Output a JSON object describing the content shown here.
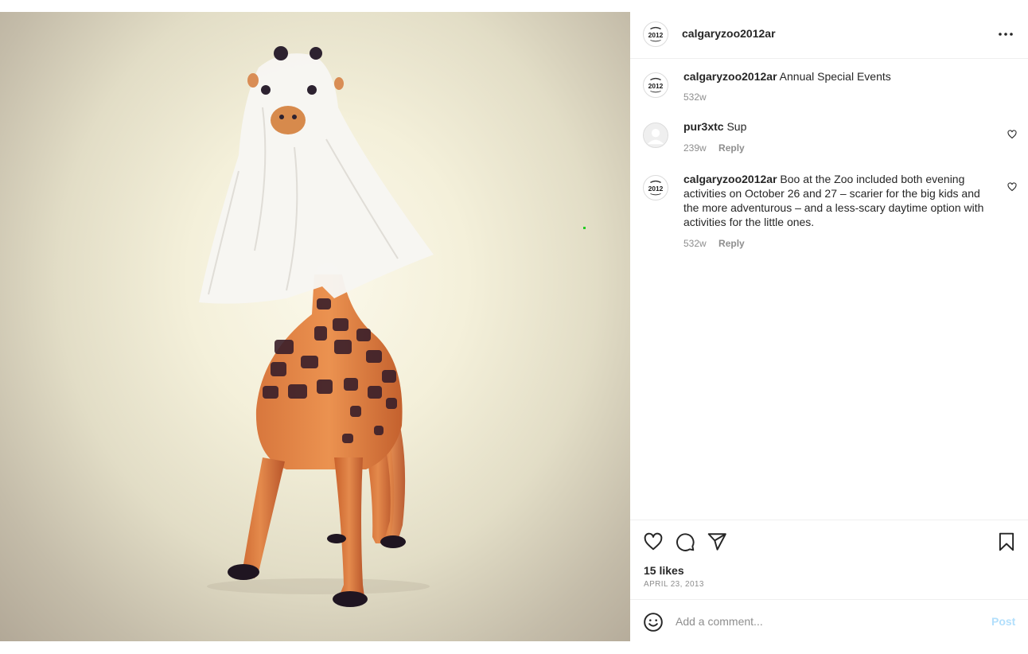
{
  "post": {
    "username": "calgaryzoo2012ar",
    "avatar_text": "2012",
    "image_alt": "Toy giraffe wearing a white tissue ghost costume"
  },
  "comments": [
    {
      "user": "calgaryzoo2012ar",
      "text": "Annual Special Events",
      "age": "532w",
      "reply": ""
    },
    {
      "user": "pur3xtc",
      "text": "Sup",
      "age": "239w",
      "reply": "Reply"
    },
    {
      "user": "calgaryzoo2012ar",
      "text": "Boo at the Zoo included both evening activities on October 26 and 27 – scarier for the big kids and the more adventurous – and a less-scary daytime option with activities for the little ones.",
      "age": "532w",
      "reply": "Reply"
    }
  ],
  "actions": {
    "likes": "15 likes",
    "date": "APRIL 23, 2013"
  },
  "add_comment": {
    "placeholder": "Add a comment...",
    "post_label": "Post"
  },
  "icons": {
    "header_more": "more-horizontal-icon",
    "like": "heart-icon",
    "comment": "comment-bubble-icon",
    "share": "paper-plane-icon",
    "save": "bookmark-icon",
    "emoji": "smiley-icon"
  },
  "colors": {
    "text": "#262626",
    "muted": "#8e8e8e",
    "post_button_disabled": "#b2dffc",
    "divider": "#efefef"
  }
}
